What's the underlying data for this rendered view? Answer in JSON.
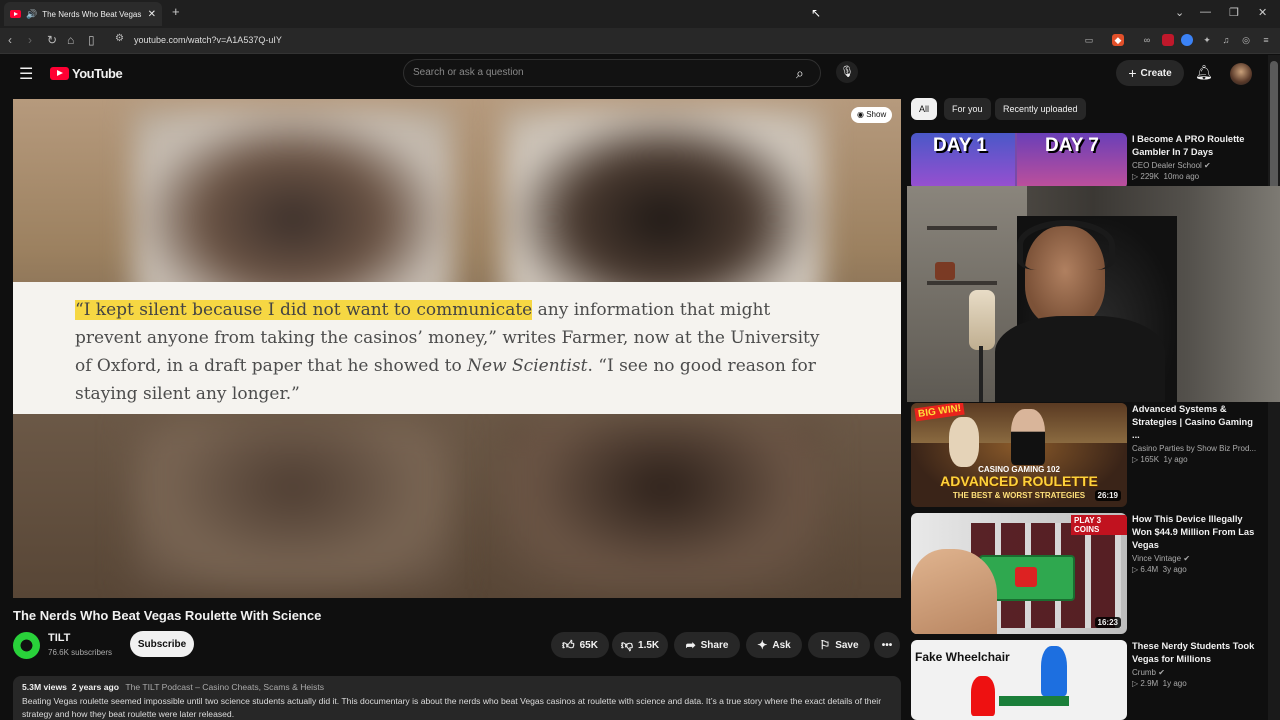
{
  "browser": {
    "tab_title": "The Nerds Who Beat Vegas R",
    "url": "youtube.com/watch?v=A1A537Q-uIY"
  },
  "header": {
    "logo_text": "YouTube",
    "search_placeholder": "Search or ask a question",
    "create_label": "Create"
  },
  "video": {
    "show_label": "Show",
    "quote_highlight": "“I kept silent because I did not want to communicate",
    "quote_rest_1": " any information that might prevent anyone from taking the casinos’ money,” writes Farmer, now at the University of Oxford, in a draft paper that he showed to ",
    "quote_italic": "New Scientist",
    "quote_rest_2": ". “I see no good reason for staying silent any longer.”",
    "title": "The Nerds Who Beat Vegas Roulette With Science"
  },
  "channel": {
    "name": "TILT",
    "subscribers": "76.6K subscribers",
    "subscribe_label": "Subscribe"
  },
  "actions": {
    "likes": "65K",
    "dislikes": "1.5K",
    "share": "Share",
    "ask": "Ask",
    "save": "Save"
  },
  "description": {
    "views": "5.3M views",
    "age": "2 years ago",
    "playlist": "The TILT Podcast – Casino Cheats, Scams & Heists",
    "text": "Beating Vegas roulette seemed impossible until two science students actually did it. This documentary is about the nerds who beat Vegas casinos at roulette with science and data. It’s a true story where the exact details of their strategy and how they beat roulette were later released."
  },
  "chips": [
    "All",
    "For you",
    "Recently uploaded"
  ],
  "recommendations": [
    {
      "title": "I Become A PRO Roulette Gambler In 7 Days",
      "channel": "CEO Dealer School",
      "views": "229K",
      "age": "10mo ago",
      "thumb_text_left": "DAY 1",
      "thumb_text_right": "DAY 7"
    },
    {
      "title": "Advanced Systems & Strategies | Casino Gaming ...",
      "channel": "Casino Parties by Show Biz Prod...",
      "views": "165K",
      "age": "1y ago",
      "duration": "26:19",
      "thumb_line1": "CASINO GAMING 102",
      "thumb_line2": "ADVANCED ROULETTE",
      "thumb_line3": "THE BEST & WORST STRATEGIES",
      "thumb_badge": "BIG WIN!"
    },
    {
      "title": "How This Device Illegally Won $44.9 Million From Las Vegas",
      "channel": "Vince Vintage",
      "views": "6.4M",
      "age": "3y ago",
      "duration": "16:23",
      "thumb_badge": "PLAY 3 COINS"
    },
    {
      "title": "These Nerdy Students Took Vegas for Millions",
      "channel": "Crumb",
      "views": "2.9M",
      "age": "1y ago",
      "thumb_text": "Fake Wheelchair"
    }
  ]
}
